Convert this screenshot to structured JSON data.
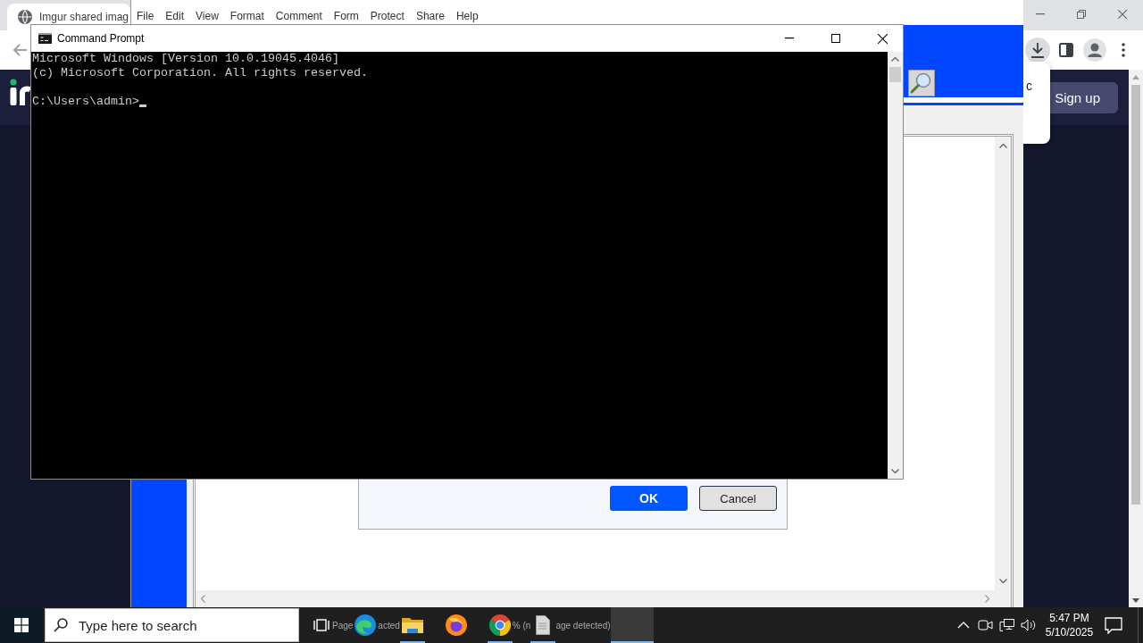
{
  "browser": {
    "tab": {
      "title": "Imgur shared imag"
    },
    "toolbar": {
      "downloads_open": true
    },
    "page": {
      "sign_up": "Sign up"
    },
    "download_popup": {
      "text": "c"
    }
  },
  "editor": {
    "menu": [
      "File",
      "Edit",
      "View",
      "Format",
      "Comment",
      "Form",
      "Protect",
      "Share",
      "Help"
    ],
    "dialog": {
      "buttons": [
        {
          "label": "OK",
          "kind": "primary"
        },
        {
          "label": "Cancel",
          "kind": "secondary"
        }
      ]
    }
  },
  "console": {
    "title": "Command Prompt",
    "banner": [
      "Microsoft Windows [Version 10.0.19045.4046]",
      "(c) Microsoft Corporation. All rights reserved."
    ],
    "prompt": "C:\\Users\\admin>",
    "cursor": true
  },
  "taskbar": {
    "search": {
      "placeholder": "Type here to search"
    },
    "apps": [
      {
        "kind": "text",
        "text": "Page"
      },
      {
        "kind": "wave",
        "running": false,
        "selected": false
      },
      {
        "kind": "text",
        "text": "acted"
      },
      {
        "kind": "folder",
        "running": true,
        "selected": false
      },
      {
        "kind": "fox",
        "running": false,
        "selected": false
      },
      {
        "kind": "ring",
        "running": true,
        "selected": false
      },
      {
        "kind": "text",
        "text": "% (n"
      },
      {
        "kind": "document",
        "running": true,
        "selected": false
      },
      {
        "kind": "text",
        "text": "age detected)"
      },
      {
        "kind": "window",
        "running": true,
        "selected": true
      }
    ],
    "clock": {
      "time": "5:47 PM",
      "date": "5/10/2025"
    }
  }
}
